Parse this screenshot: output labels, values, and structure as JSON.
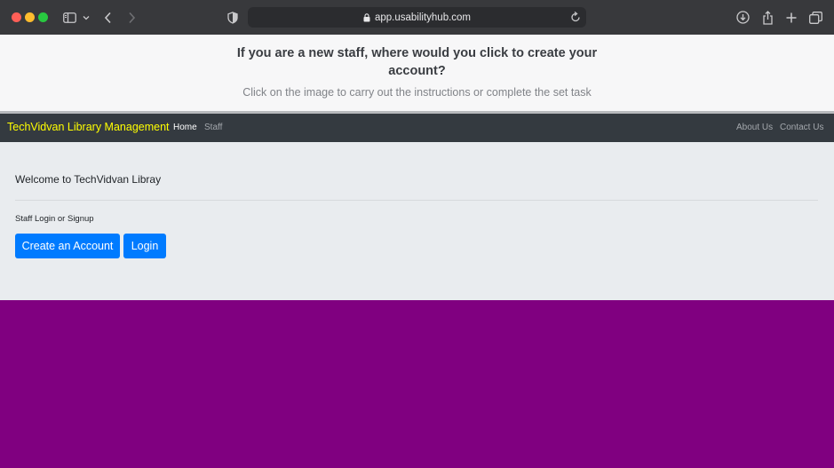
{
  "browser": {
    "url": "app.usabilityhub.com",
    "icons": [
      "sidebar-icon",
      "chevron-down-icon",
      "back-icon",
      "forward-icon",
      "shield-icon",
      "lock-icon",
      "reload-icon",
      "download-icon",
      "share-icon",
      "plus-icon",
      "tabs-icon"
    ]
  },
  "task": {
    "question": "If you are a new staff, where would you click to create your account?",
    "instruction": "Click on the image to carry out the instructions or complete the set task"
  },
  "navbar": {
    "brand": "TechVidvan Library Management",
    "links_left": [
      {
        "label": "Home",
        "active": true
      },
      {
        "label": "Staff",
        "active": false
      }
    ],
    "links_right": [
      {
        "label": "About Us"
      },
      {
        "label": "Contact Us"
      }
    ]
  },
  "main": {
    "welcome": "Welcome to TechVidvan Libray",
    "login_label": "Staff Login or Signup",
    "create_button": "Create an Account",
    "login_button": "Login"
  },
  "colors": {
    "brand": "#ffff00",
    "primary_button": "#007bff",
    "navbar_bg": "#343a40",
    "content_bg": "#e9ecef",
    "page_bg": "#800080"
  }
}
